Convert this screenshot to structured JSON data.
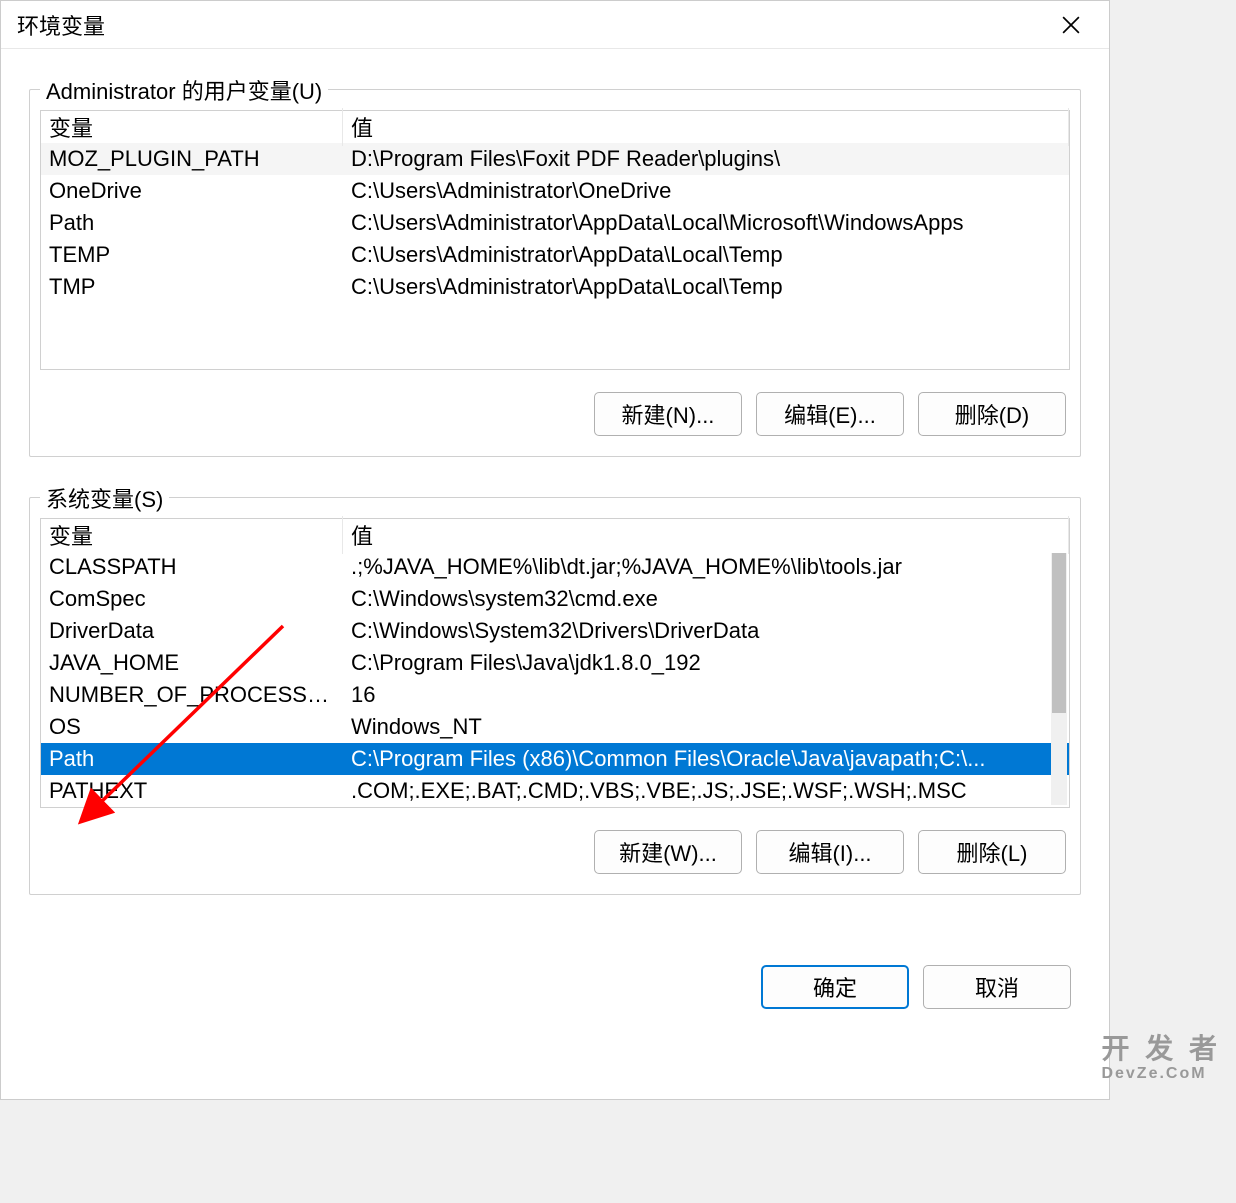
{
  "dialog": {
    "title": "环境变量"
  },
  "user_group": {
    "label": "Administrator 的用户变量(U)",
    "columns": {
      "name": "变量",
      "value": "值"
    },
    "rows": [
      {
        "name": "MOZ_PLUGIN_PATH",
        "value": "D:\\Program Files\\Foxit PDF Reader\\plugins\\",
        "alt": true
      },
      {
        "name": "OneDrive",
        "value": "C:\\Users\\Administrator\\OneDrive",
        "alt": false
      },
      {
        "name": "Path",
        "value": "C:\\Users\\Administrator\\AppData\\Local\\Microsoft\\WindowsApps",
        "alt": false
      },
      {
        "name": "TEMP",
        "value": "C:\\Users\\Administrator\\AppData\\Local\\Temp",
        "alt": false
      },
      {
        "name": "TMP",
        "value": "C:\\Users\\Administrator\\AppData\\Local\\Temp",
        "alt": false
      }
    ],
    "buttons": {
      "new": "新建(N)...",
      "edit": "编辑(E)...",
      "delete": "删除(D)"
    }
  },
  "system_group": {
    "label": "系统变量(S)",
    "columns": {
      "name": "变量",
      "value": "值"
    },
    "rows": [
      {
        "name": "CLASSPATH",
        "value": ".;%JAVA_HOME%\\lib\\dt.jar;%JAVA_HOME%\\lib\\tools.jar",
        "alt": false
      },
      {
        "name": "ComSpec",
        "value": "C:\\Windows\\system32\\cmd.exe",
        "alt": false
      },
      {
        "name": "DriverData",
        "value": "C:\\Windows\\System32\\Drivers\\DriverData",
        "alt": false
      },
      {
        "name": "JAVA_HOME",
        "value": "C:\\Program Files\\Java\\jdk1.8.0_192",
        "alt": false
      },
      {
        "name": "NUMBER_OF_PROCESSORS",
        "value": "16",
        "alt": false
      },
      {
        "name": "OS",
        "value": "Windows_NT",
        "alt": false
      },
      {
        "name": "Path",
        "value": "C:\\Program Files (x86)\\Common Files\\Oracle\\Java\\javapath;C:\\...",
        "selected": true
      },
      {
        "name": "PATHEXT",
        "value": ".COM;.EXE;.BAT;.CMD;.VBS;.VBE;.JS;.JSE;.WSF;.WSH;.MSC",
        "alt": false
      }
    ],
    "buttons": {
      "new": "新建(W)...",
      "edit": "编辑(I)...",
      "delete": "删除(L)"
    }
  },
  "dialog_buttons": {
    "ok": "确定",
    "cancel": "取消"
  },
  "watermark": {
    "line1": "开 发 者",
    "line2": "DevZe.CoM"
  }
}
